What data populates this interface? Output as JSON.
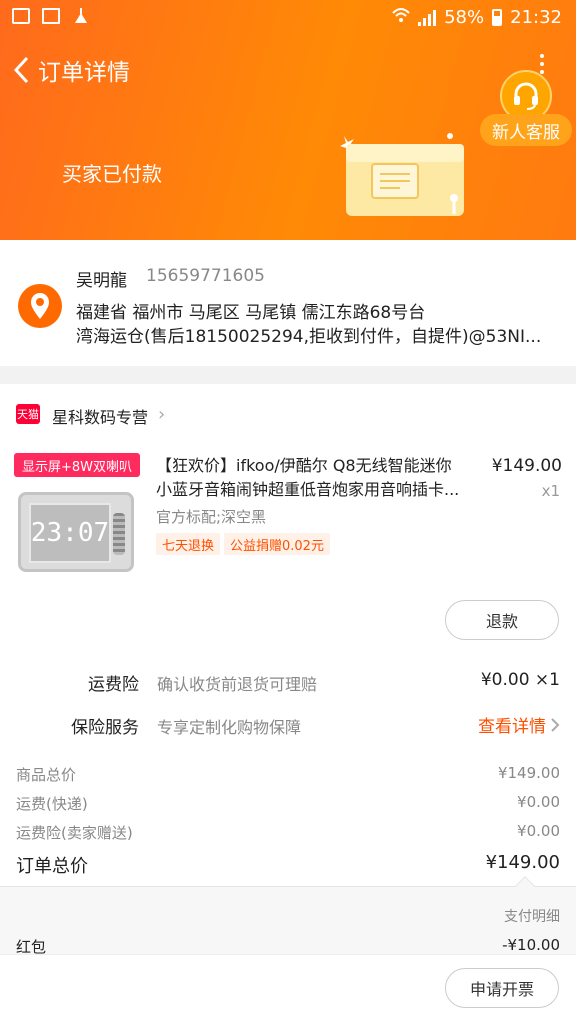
{
  "status_bar": {
    "battery": "58%",
    "time": "21:32",
    "icons": [
      "image-icon",
      "mail-icon",
      "cleaner-icon",
      "wifi-icon",
      "signal-icon",
      "battery-icon"
    ]
  },
  "header": {
    "title": "订单详情",
    "service_label": "新人客服",
    "order_status": "买家已付款",
    "colors": {
      "primary": "#ff6a1c",
      "secondary": "#ff8a06"
    }
  },
  "address": {
    "name": "吴明龍",
    "phone": "15659771605",
    "line1": "福建省 福州市 马尾区 马尾镇 儒江东路68号台",
    "line2": "湾海运仓(售后18150025294,拒收到付件，自提件)@53NI..."
  },
  "shop": {
    "badge": "天猫",
    "name": "星科数码专营"
  },
  "product": {
    "banner": "显示屏+8W双喇叭",
    "title_line1": "【狂欢价】ifkoo/伊酷尔 Q8无线智能迷你",
    "title_line2": "小蓝牙音箱闹钟超重低音炮家用音响插卡...",
    "price": "¥149.00",
    "quantity": "x1",
    "spec": "官方标配;深空黑",
    "tags": [
      "七天退换",
      "公益捐赠0.02元"
    ],
    "clock_text": "23:07",
    "refund_label": "退款"
  },
  "services": {
    "shipping_insurance": {
      "label": "运费险",
      "desc": "确认收货前退货可理赔",
      "value": "¥0.00 ×1"
    },
    "insurance": {
      "label": "保险服务",
      "desc": "专享定制化购物保障",
      "link": "查看详情"
    }
  },
  "summary": {
    "rows": [
      {
        "label": "商品总价",
        "value": "¥149.00"
      },
      {
        "label": "运费(快递)",
        "value": "¥0.00"
      },
      {
        "label": "运费险(卖家赠送)",
        "value": "¥0.00"
      }
    ],
    "total_label": "订单总价",
    "total_value": "¥149.00"
  },
  "payment": {
    "detail_label": "支付明细",
    "red_packet_label": "红包",
    "red_packet_value": "-¥10.00"
  },
  "footer": {
    "invoice_label": "申请开票"
  }
}
